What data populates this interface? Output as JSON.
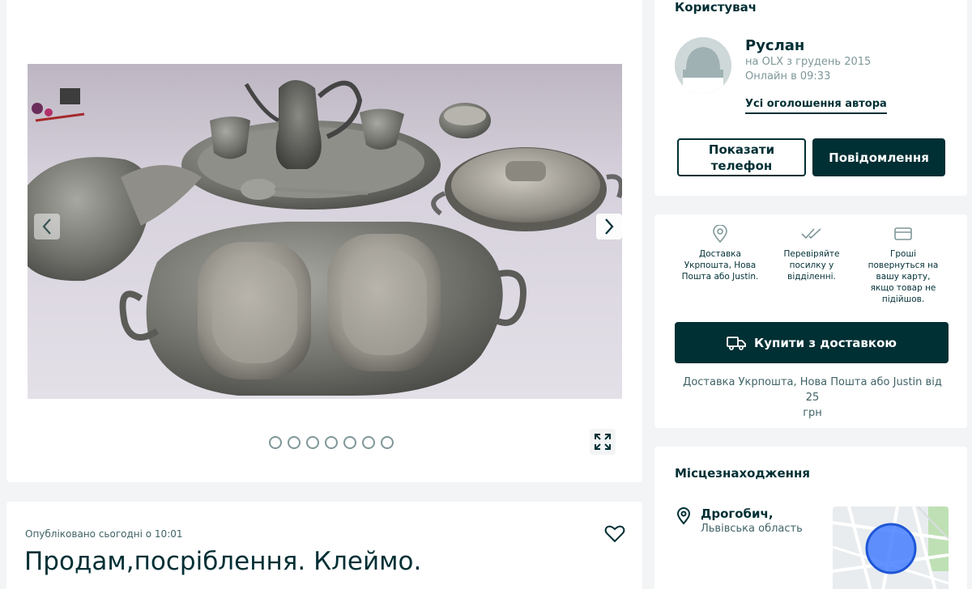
{
  "gallery": {
    "image_count": 7,
    "active_index": 0
  },
  "ad": {
    "published": "Опубліковано сьогодні о 10:01",
    "title": "Продам,посріблення. Клеймо."
  },
  "user": {
    "section_title": "Користувач",
    "name": "Руслан",
    "since": "на OLX з грудень 2015",
    "online": "Онлайн в 09:33",
    "all_ads_link": "Усі оголошення автора",
    "show_phone_line1": "Показати",
    "show_phone_line2": "телефон",
    "message_button": "Повідомлення"
  },
  "delivery": {
    "features": [
      {
        "icon": "location-pin-icon",
        "lines": [
          "Доставка",
          "Укрпошта, Нова",
          "Пошта або Justin."
        ]
      },
      {
        "icon": "double-check-icon",
        "lines": [
          "Перевіряйте",
          "посилку у",
          "відділенні."
        ]
      },
      {
        "icon": "card-icon",
        "lines": [
          "Гроші",
          "повернуться на",
          "вашу карту,",
          "якщо товар не",
          "підійшов."
        ]
      }
    ],
    "buy_button": "Купити з доставкою",
    "price_line1": "Доставка Укрпошта, Нова Пошта або Justin від 25",
    "price_line2": "грн"
  },
  "location": {
    "title": "Місцезнаходження",
    "city": "Дрогобич,",
    "region": "Львівська область"
  },
  "colors": {
    "primary": "#002f34",
    "page_bg": "#f2f4f5",
    "muted": "#7f9799",
    "map_circle": "#3a77ff"
  }
}
